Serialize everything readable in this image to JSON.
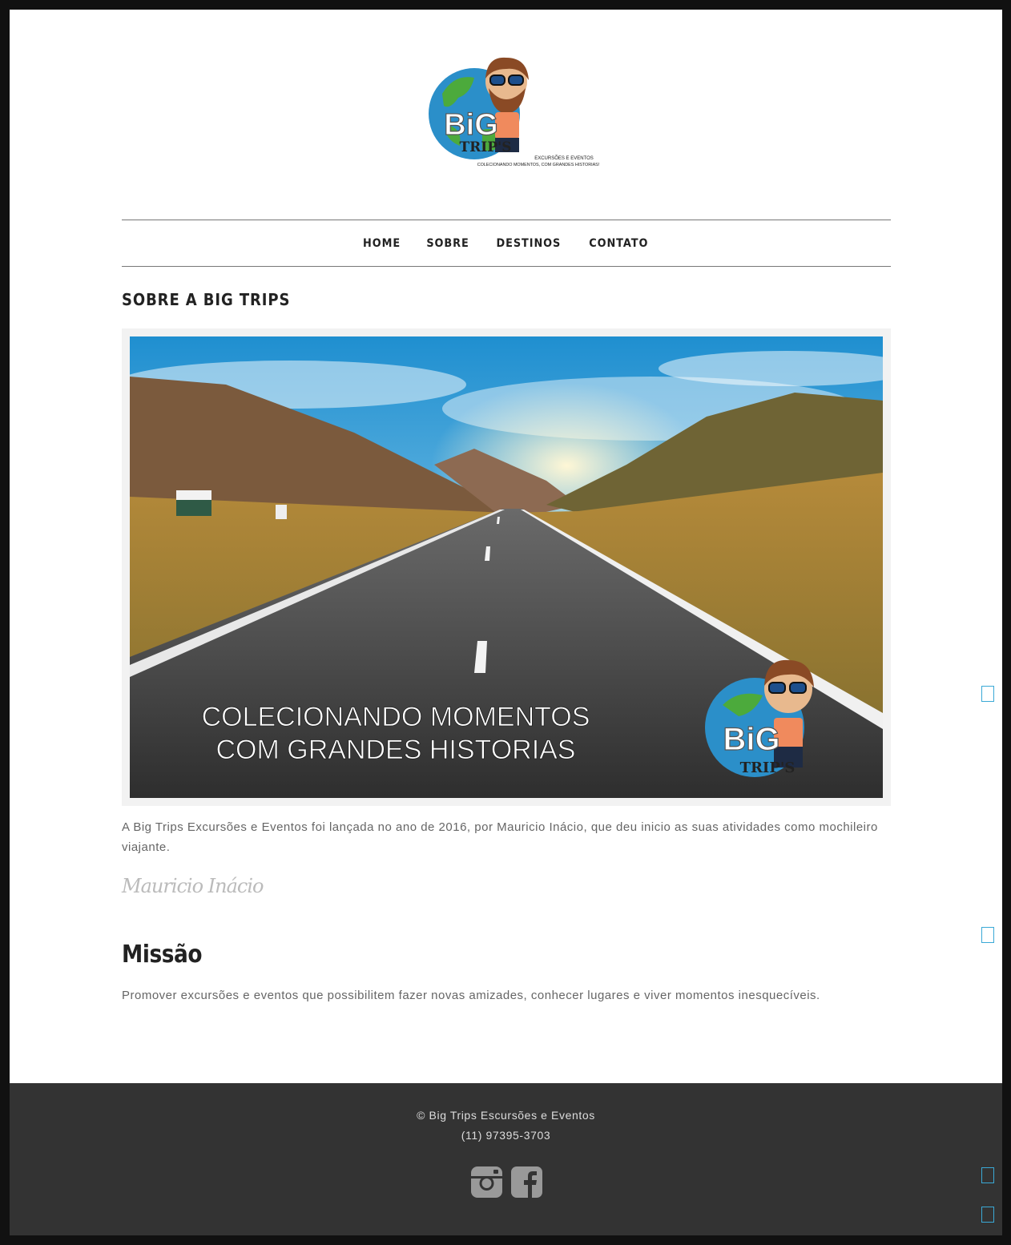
{
  "logo": {
    "brand_top": "BiG",
    "brand_bottom": "TRIP'S",
    "tagline1": "EXCURSÕES E EVENTOS",
    "tagline2": "COLECIONANDO MOMENTOS, COM GRANDES HISTORIAS!"
  },
  "nav": {
    "items": [
      {
        "label": "HOME"
      },
      {
        "label": "SOBRE"
      },
      {
        "label": "DESTINOS"
      },
      {
        "label": "CONTATO"
      }
    ]
  },
  "page": {
    "title": "SOBRE A BIG TRIPS"
  },
  "hero": {
    "line1": "COLECIONANDO MOMENTOS",
    "line2": "COM GRANDES HISTORIAS",
    "badge_top": "BiG",
    "badge_bottom": "TRIP'S"
  },
  "intro": {
    "text": "A Big Trips Excursões e Eventos foi lançada no ano de 2016, por Mauricio Inácio, que deu inicio as suas atividades como mochileiro viajante."
  },
  "signature": {
    "text": "Mauricio Inácio"
  },
  "mission": {
    "title": "Missão",
    "text": "Promover excursões e eventos que possibilitem fazer novas amizades, conhecer lugares e viver momentos inesquecíveis."
  },
  "footer": {
    "copyright": "© Big Trips Escursões e Eventos",
    "phone": "(11) 97395-3703",
    "social": [
      {
        "icon": "instagram-icon"
      },
      {
        "icon": "facebook-icon"
      }
    ]
  },
  "colors": {
    "footer_bg": "#333333",
    "text_muted": "#666666",
    "heading": "#222222",
    "side_accent": "#3aa9d6"
  }
}
